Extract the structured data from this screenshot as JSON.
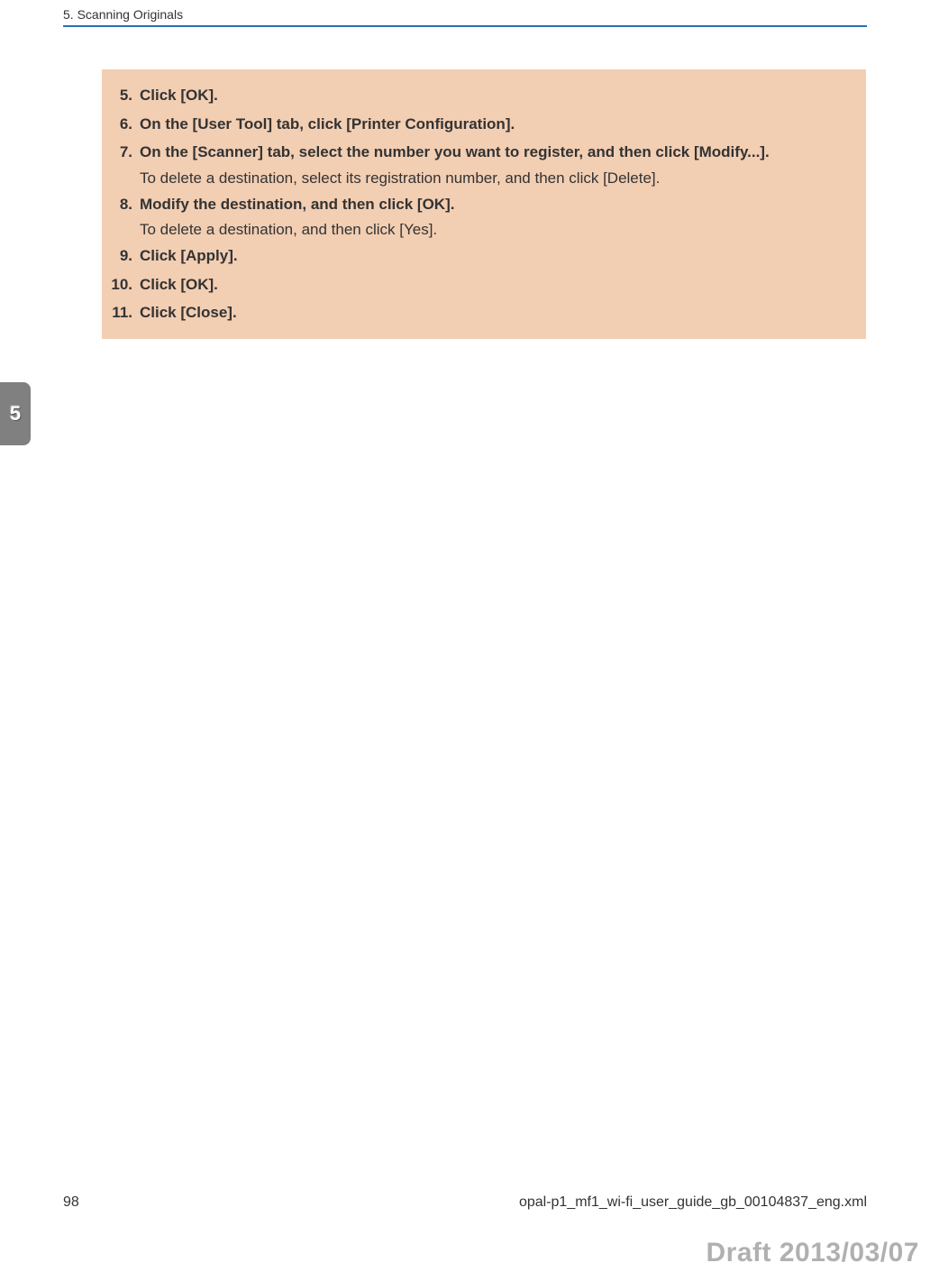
{
  "header": "5. Scanning Originals",
  "chapter_tab": "5",
  "steps": [
    {
      "num": "5.",
      "main": "Click [OK]."
    },
    {
      "num": "6.",
      "main": "On the [User Tool] tab, click [Printer Configuration]."
    },
    {
      "num": "7.",
      "main": "On the [Scanner] tab, select the number you want to register, and then click [Modify...].",
      "sub": "To delete a destination, select its registration number, and then click [Delete]."
    },
    {
      "num": "8.",
      "main": "Modify the destination, and then click [OK].",
      "sub": "To delete a destination, and then click [Yes]."
    },
    {
      "num": "9.",
      "main": "Click [Apply]."
    },
    {
      "num": "10.",
      "main": "Click [OK]."
    },
    {
      "num": "11.",
      "main": "Click [Close]."
    }
  ],
  "page_number": "98",
  "file_ref": "opal-p1_mf1_wi-fi_user_guide_gb_00104837_eng.xml",
  "draft_stamp": "Draft 2013/03/07"
}
